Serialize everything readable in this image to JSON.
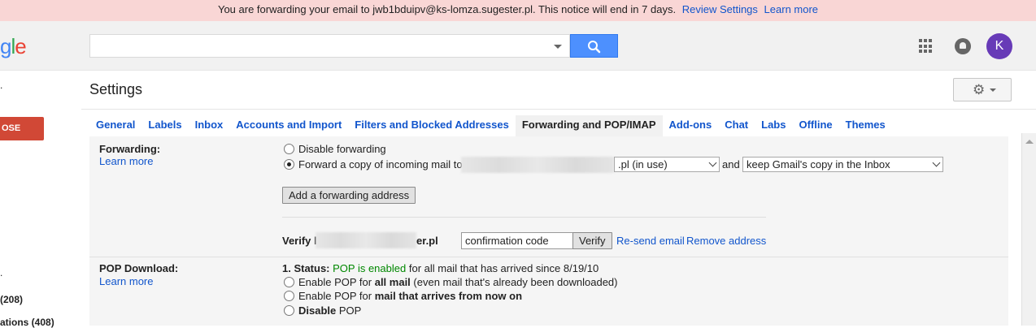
{
  "notice": {
    "text": "You are forwarding your email to jwb1bduipv@ks-lomza.sugester.pl. This notice will end in 7 days.",
    "review_label": "Review Settings",
    "learn_label": "Learn more"
  },
  "header": {
    "logo_partial": "gle",
    "avatar_letter": "K"
  },
  "search": {
    "value": ""
  },
  "left_nav": {
    "compose_label": "OSE",
    "count_1": "(208)",
    "count_2": "ations (408)"
  },
  "page_title": "Settings",
  "tabs": [
    {
      "label": "General"
    },
    {
      "label": "Labels"
    },
    {
      "label": "Inbox"
    },
    {
      "label": "Accounts and Import"
    },
    {
      "label": "Filters and Blocked Addresses"
    },
    {
      "label": "Forwarding and POP/IMAP",
      "active": true
    },
    {
      "label": "Add-ons"
    },
    {
      "label": "Chat"
    },
    {
      "label": "Labs"
    },
    {
      "label": "Offline"
    },
    {
      "label": "Themes"
    }
  ],
  "forwarding": {
    "label": "Forwarding:",
    "learn_more": "Learn more",
    "disable_label": "Disable forwarding",
    "forward_label": "Forward a copy of incoming mail to",
    "address_select_suffix": ".pl (in use)",
    "and_label": "and",
    "action_select": "keep Gmail's copy in the Inbox",
    "add_button": "Add a forwarding address",
    "verify_prefix": "Verify l",
    "verify_suffix": "er.pl",
    "confirmation_value": "confirmation code",
    "verify_button": "Verify",
    "resend_link": "Re-send email",
    "remove_link": "Remove address"
  },
  "pop": {
    "label": "POP Download:",
    "learn_more": "Learn more",
    "status_prefix": "1. Status: ",
    "status_value": "POP is enabled",
    "status_suffix": " for all mail that has arrived since 8/19/10",
    "opt1_prefix": "Enable POP for ",
    "opt1_bold": "all mail",
    "opt1_suffix": " (even mail that's already been downloaded)",
    "opt2_prefix": "Enable POP for ",
    "opt2_bold": "mail that arrives from now on",
    "opt3_bold": "Disable",
    "opt3_suffix": " POP"
  },
  "colors": {
    "notice_bg": "#f9d6d5",
    "link": "#1155cc",
    "compose": "#d14836",
    "search_button": "#4d90fe",
    "avatar": "#673ab7",
    "status_green": "#008800"
  }
}
